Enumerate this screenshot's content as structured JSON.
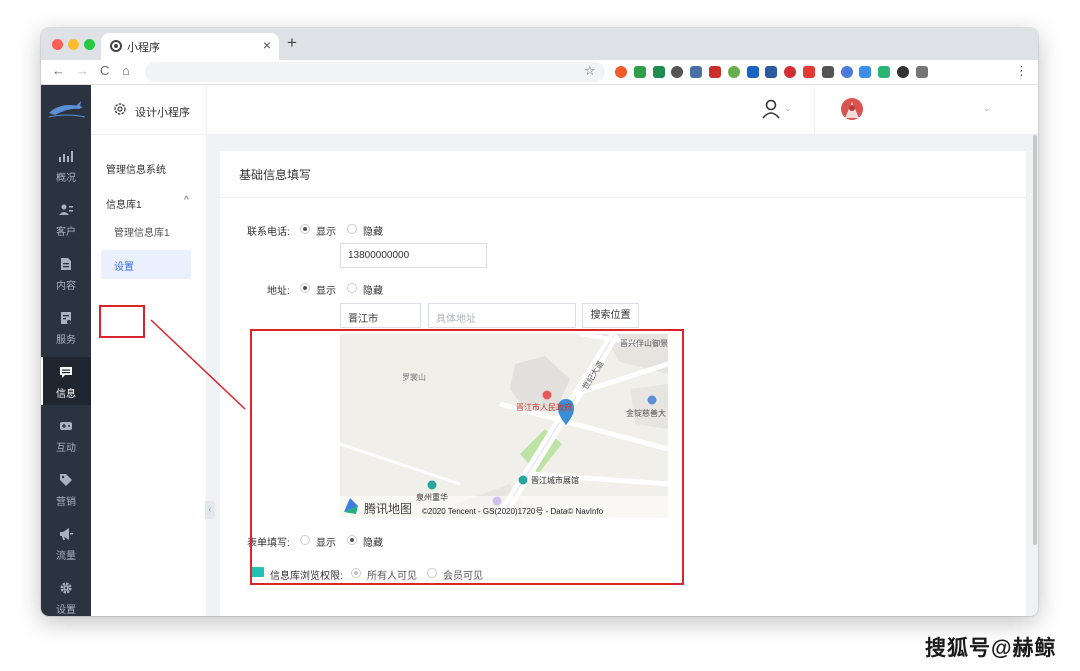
{
  "browser": {
    "tab_title": "小程序",
    "tab_close": "×",
    "new_tab": "+",
    "nav": {
      "back": "←",
      "forward": "→",
      "reload": "C",
      "home": "⌂"
    },
    "star": "☆",
    "menu": "⋮",
    "extensions": [
      "#f45b2b",
      "#2e9e47",
      "#1e8b4f",
      "#555555",
      "#4a6fa5",
      "#c9302c",
      "#68b04d",
      "#1565c0",
      "#2c5aa0",
      "#d32f2f",
      "#e53935",
      "#555555",
      "#4a7bd8",
      "#3b8eea",
      "#2bb673",
      "#333333",
      "#777777"
    ]
  },
  "sidebar": {
    "items": [
      {
        "label": "概况",
        "icon": "chart-icon"
      },
      {
        "label": "客户",
        "icon": "users-icon"
      },
      {
        "label": "内容",
        "icon": "document-icon"
      },
      {
        "label": "服务",
        "icon": "service-icon"
      },
      {
        "label": "信息",
        "icon": "message-icon"
      },
      {
        "label": "互动",
        "icon": "gamepad-icon"
      },
      {
        "label": "营销",
        "icon": "tag-icon"
      },
      {
        "label": "流量",
        "icon": "megaphone-icon"
      },
      {
        "label": "设置",
        "icon": "gear-icon"
      }
    ],
    "active": "信息"
  },
  "subnav": {
    "header": "设计小程序",
    "group1": "管理信息系统",
    "group2": "信息库1",
    "group2_caret": "^",
    "child": "管理信息库1",
    "selected": "设置",
    "collapse": "‹"
  },
  "topbar": {
    "caret1": "⌄",
    "caret2": "⌄"
  },
  "form": {
    "title": "基础信息填写",
    "phone": {
      "label": "联系电话:",
      "show": "显示",
      "hide": "隐藏",
      "value": "13800000000"
    },
    "address": {
      "label": "地址:",
      "show": "显示",
      "hide": "隐藏",
      "city": "晋江市",
      "detail_placeholder": "具体地址",
      "search_button": "搜索位置"
    },
    "form_fill": {
      "label": "表单填写:",
      "show": "显示",
      "hide": "隐藏"
    },
    "browse": {
      "label": "信息库浏览权限:",
      "all": "所有人可见",
      "members": "会员可见"
    }
  },
  "map": {
    "labels": {
      "luoshan": "罗裳山",
      "xingwu": "晋兴伴山御景",
      "city_gov": "晋江市人民政府",
      "jinyi": "金锭慈善大",
      "exhibit": "晋江城市展馆",
      "quanzhou": "泉州重华",
      "road": "世纪大道"
    },
    "brand": "腾讯地图",
    "copyright": "©2020 Tencent - GS(2020)1720号 - Data© NavInfo"
  },
  "watermark": "搜狐号@赫鲸"
}
